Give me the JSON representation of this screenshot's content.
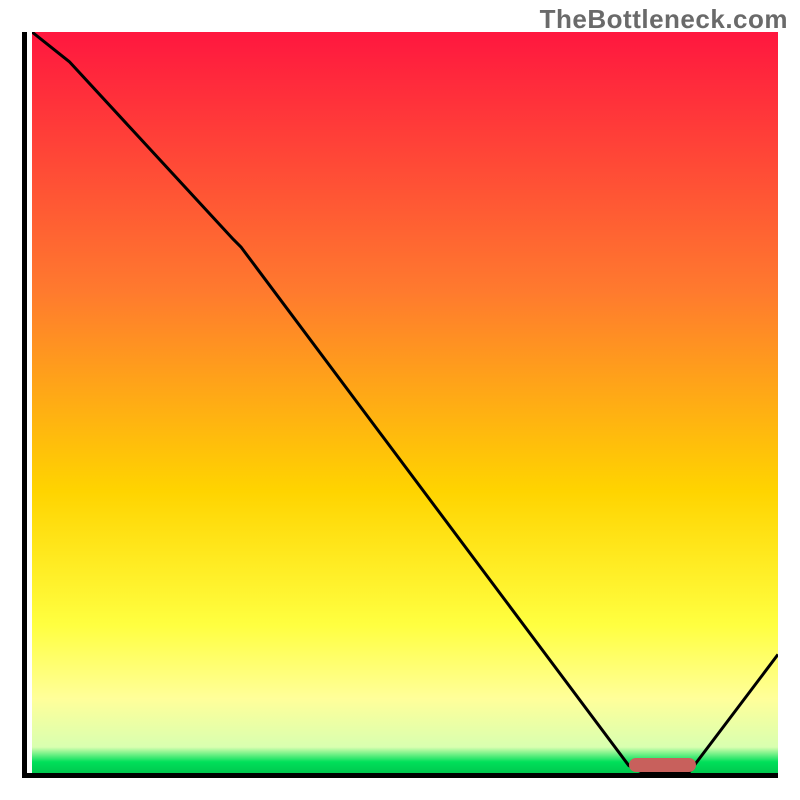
{
  "watermark": "TheBottleneck.com",
  "colors": {
    "grad_top": "#ff173f",
    "grad_mid1": "#ff7a2e",
    "grad_mid2": "#ffd400",
    "grad_pale": "#ffff9a",
    "grad_green": "#00e05a",
    "line": "#000000",
    "marker": "#c8605c",
    "axis": "#000000"
  },
  "gradient_stops": [
    {
      "offset": 0.0,
      "color": "#ff173f"
    },
    {
      "offset": 0.35,
      "color": "#ff7a2e"
    },
    {
      "offset": 0.62,
      "color": "#ffd400"
    },
    {
      "offset": 0.8,
      "color": "#ffff40"
    },
    {
      "offset": 0.9,
      "color": "#ffff9a"
    },
    {
      "offset": 0.965,
      "color": "#d9ffb0"
    },
    {
      "offset": 0.985,
      "color": "#00e05a"
    },
    {
      "offset": 1.0,
      "color": "#00c84f"
    }
  ],
  "chart_data": {
    "type": "line",
    "title": "",
    "xlabel": "",
    "ylabel": "",
    "xlim": [
      0,
      100
    ],
    "ylim": [
      0,
      100
    ],
    "x": [
      0,
      5,
      27,
      28,
      80,
      82,
      88,
      100
    ],
    "values": [
      100,
      96,
      72,
      71,
      1,
      0,
      0,
      16
    ],
    "marker": {
      "x_start": 80,
      "x_end": 89,
      "y": 0.6
    }
  }
}
